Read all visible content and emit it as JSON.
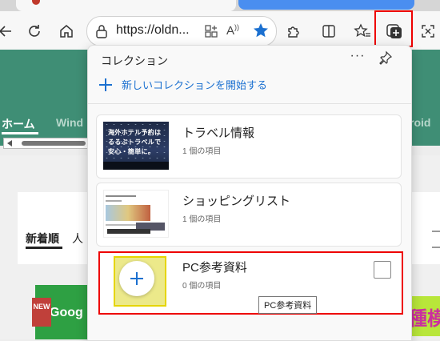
{
  "browser": {
    "url": "https://oldn..."
  },
  "page": {
    "nav_home": "ホーム",
    "nav_partial_left": "Wind",
    "nav_partial_right": "roid",
    "tab_new": "新着順",
    "tab_popular_partial": "人",
    "badge_new": "NEW",
    "ad_text": "Goog",
    "ad_text_right": "種模"
  },
  "collections": {
    "title": "コレクション",
    "more_label": "···",
    "new_label": "新しいコレクションを開始する",
    "items": [
      {
        "name": "トラベル情報",
        "count": "1 個の項目",
        "thumb_text": [
          "海外ホテル予約は",
          "るるぶトラベルで",
          "安心・簡単に。"
        ]
      },
      {
        "name": "ショッピングリスト",
        "count": "1 個の項目"
      },
      {
        "name": "PC参考資料",
        "count": "0 個の項目"
      }
    ],
    "tooltip": "PC参考資料"
  },
  "colors": {
    "accent": "#1b70d0",
    "highlight_border": "#ee0000",
    "page_band": "#3f8e75",
    "favorite_star": "#1b70d0"
  }
}
